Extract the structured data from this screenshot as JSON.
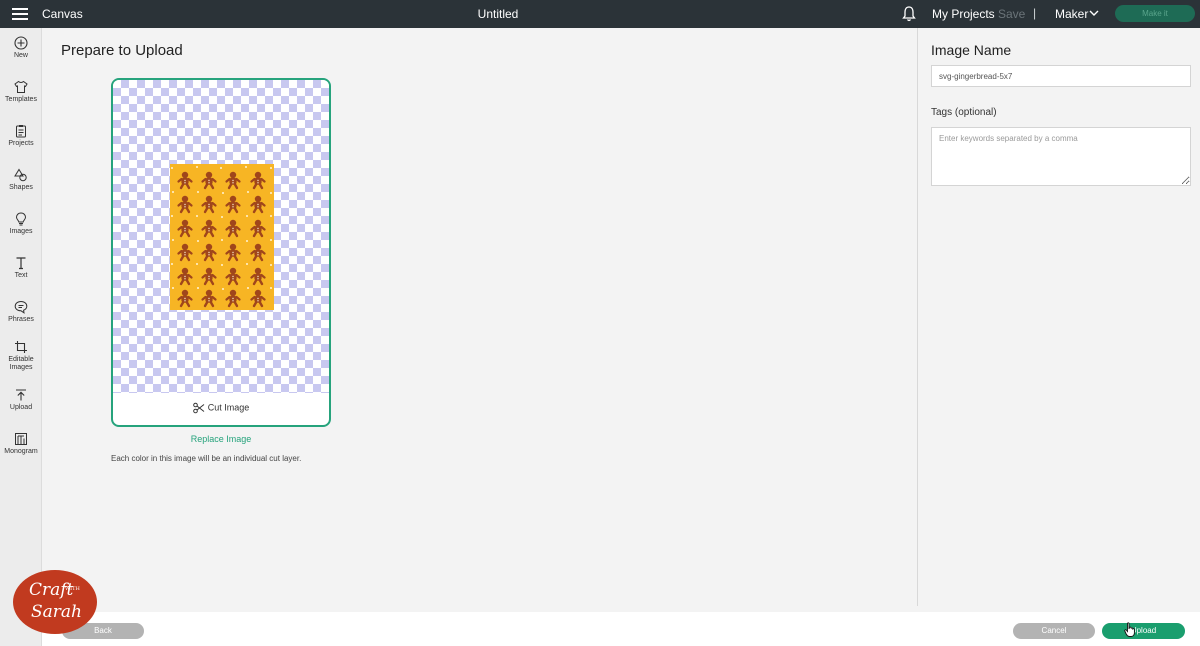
{
  "header": {
    "app_title": "Canvas",
    "document_title": "Untitled",
    "my_projects": "My Projects",
    "save": "Save",
    "separator": "|",
    "machine": "Maker",
    "make_it": "Make it"
  },
  "sidebar": {
    "items": [
      {
        "label": "New",
        "icon": "plus-circle-icon"
      },
      {
        "label": "Templates",
        "icon": "shirt-icon"
      },
      {
        "label": "Projects",
        "icon": "clipboard-icon"
      },
      {
        "label": "Shapes",
        "icon": "shapes-icon"
      },
      {
        "label": "Images",
        "icon": "lightbulb-icon"
      },
      {
        "label": "Text",
        "icon": "text-icon"
      },
      {
        "label": "Phrases",
        "icon": "speech-bubble-icon"
      },
      {
        "label": "Editable Images",
        "icon": "crop-icon"
      },
      {
        "label": "Upload",
        "icon": "upload-icon"
      },
      {
        "label": "Monogram",
        "icon": "monogram-icon"
      }
    ]
  },
  "main": {
    "title": "Prepare to Upload",
    "cut_image_label": "Cut Image",
    "replace_image": "Replace Image",
    "help_text": "Each color in this image will be an individual cut layer."
  },
  "right_panel": {
    "image_name_label": "Image Name",
    "image_name_value": "svg-gingerbread-5x7",
    "tags_label": "Tags (optional)",
    "tags_placeholder": "Enter keywords separated by a comma"
  },
  "footer": {
    "back": "Back",
    "cancel": "Cancel",
    "upload": "Upload"
  },
  "watermark": {
    "line1": "Craft",
    "with": "WITH",
    "line2": "Sarah"
  },
  "colors": {
    "accent": "#26a37c",
    "topbar": "#2b3338",
    "upload_button": "#1a9e6e",
    "artwork_background": "#f7b524",
    "gingerbread": "#a0461b"
  }
}
